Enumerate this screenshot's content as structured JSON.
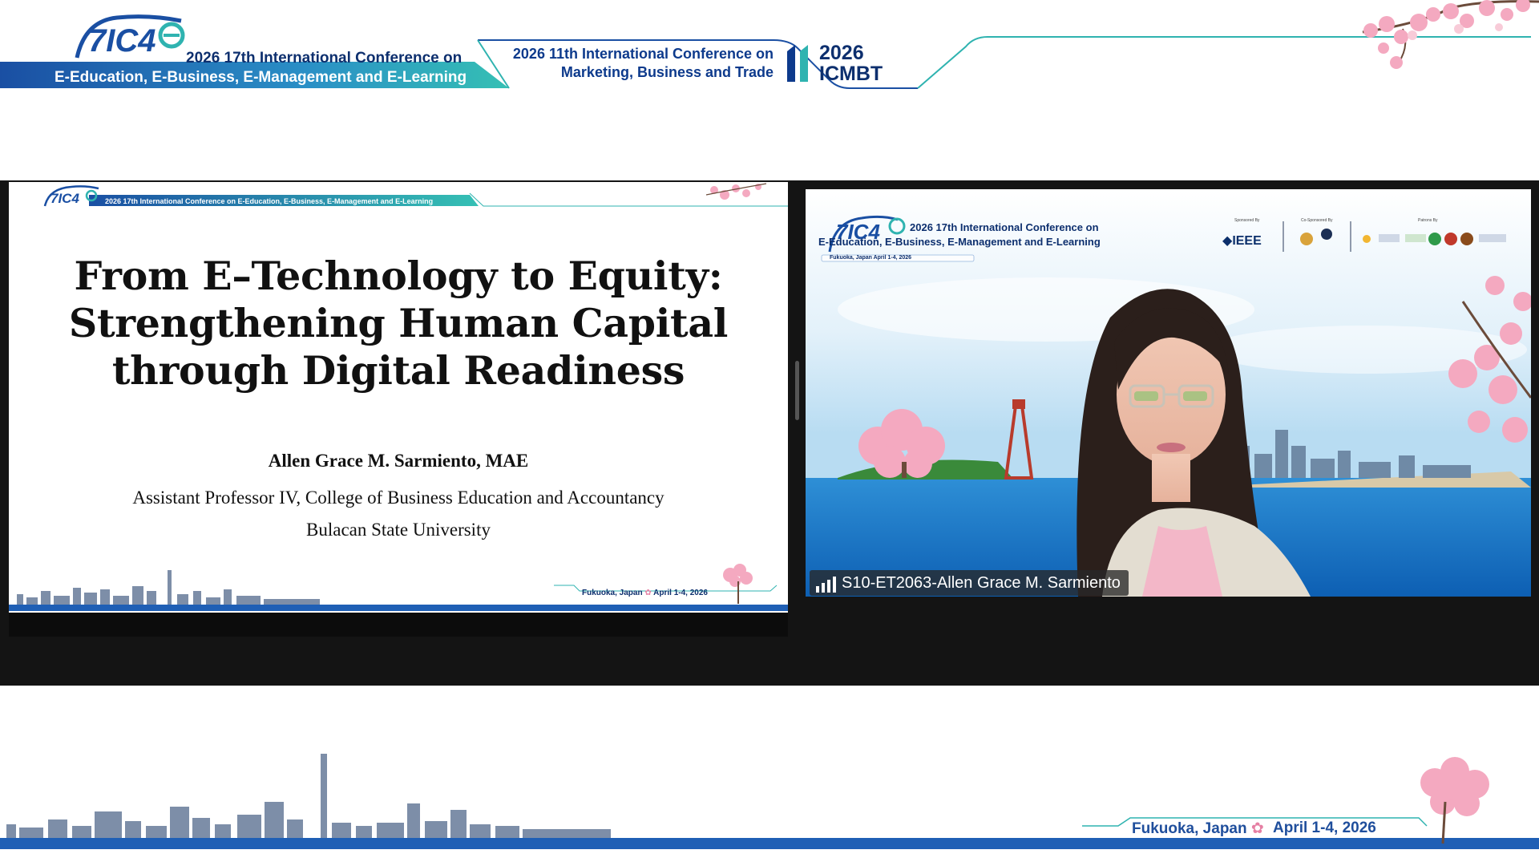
{
  "header": {
    "conf1": {
      "logo_text": "7IC4E",
      "title": "2026 17th International Conference on",
      "subtitle": "E-Education, E-Business, E-Management and E-Learning"
    },
    "conf2": {
      "title_line1": "2026 11th International Conference on",
      "title_line2": "Marketing, Business and Trade",
      "logo_year": "2026",
      "logo_name": "ICMBT"
    }
  },
  "slide": {
    "header_text": "2026 17th International Conference on E-Education, E-Business, E-Management and E-Learning",
    "title_lines": [
      "From E–Technology to Equity:",
      "Strengthening Human Capital",
      "through Digital Readiness"
    ],
    "author": "Allen Grace M. Sarmiento, MAE",
    "affiliation_line1": "Assistant Professor IV, College of Business Education and Accountancy",
    "affiliation_line2": "Bulacan State University",
    "footer_location": "Fukuoka, Japan",
    "footer_date": "April 1-4, 2026"
  },
  "video_tile": {
    "bg_title": "2026 17th International Conference on",
    "bg_subtitle": "E-Education, E-Business, E-Management and E-Learning",
    "bg_date": "Fukuoka, Japan  April 1-4, 2026",
    "sponsored_label": "Sponsored By",
    "cosponsored_label": "Co-Sponsored By",
    "patrons_label": "Patrons By",
    "ieee": "IEEE",
    "participant_name": "S10-ET2063-Allen Grace M. Sarmiento"
  },
  "footer": {
    "location": "Fukuoka, Japan",
    "date": "April 1-4, 2026"
  },
  "colors": {
    "brand_navy": "#0d2f6e",
    "brand_blue": "#1f5fb5",
    "teal": "#2fb3b0",
    "stage_bg": "#141414"
  }
}
